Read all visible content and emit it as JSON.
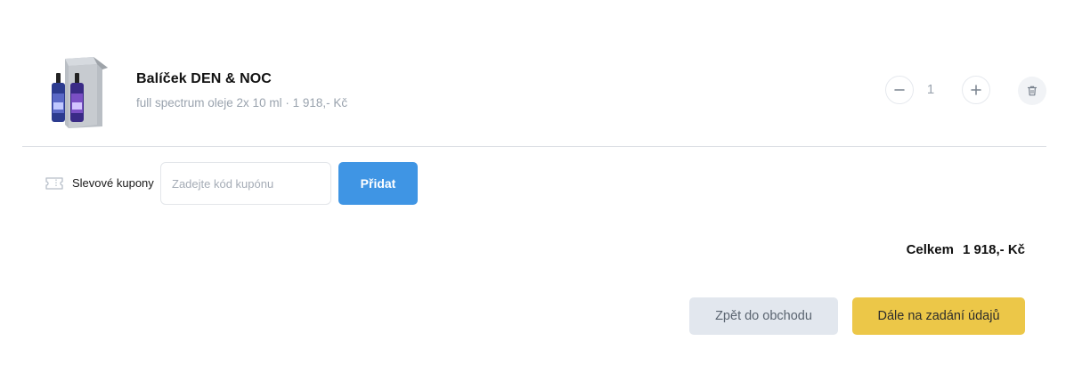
{
  "cart": {
    "item": {
      "name": "Balíček DEN & NOC",
      "description": "full spectrum oleje 2x 10 ml · 1 918,- Kč",
      "quantity": "1",
      "image_icon": "product-box-with-bottles",
      "minus_icon": "minus-icon",
      "plus_icon": "plus-icon",
      "delete_icon": "trash-icon"
    }
  },
  "coupon": {
    "icon": "ticket-icon",
    "label": "Slevové kupony",
    "placeholder": "Zadejte kód kupónu",
    "add_label": "Přidat"
  },
  "summary": {
    "total_label": "Celkem",
    "total_value": "1 918,- Kč"
  },
  "actions": {
    "back_label": "Zpět do obchodu",
    "next_label": "Dále na zadání údajů"
  },
  "colors": {
    "accent_blue": "#3f95e4",
    "accent_yellow": "#ecc748",
    "secondary_gray": "#e2e7ee",
    "muted_text": "#9aa3ae"
  }
}
